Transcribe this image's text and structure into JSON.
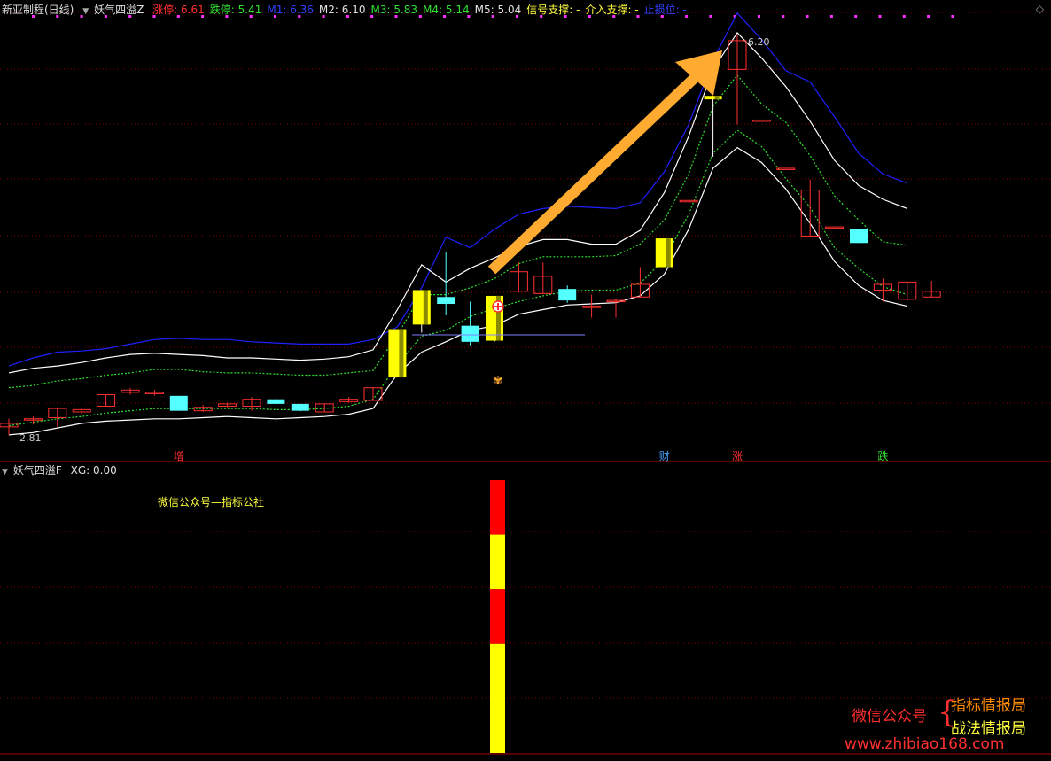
{
  "main_header": {
    "title": "新亚制程(日线)",
    "indicator": "妖气四溢Z",
    "items": [
      {
        "label": "涨停: 6.61",
        "color": "red"
      },
      {
        "label": "跌停: 5.41",
        "color": "green"
      },
      {
        "label": "M1: 6.36",
        "color": "blue"
      },
      {
        "label": "M2: 6.10",
        "color": "white"
      },
      {
        "label": "M3: 5.83",
        "color": "green"
      },
      {
        "label": "M4: 5.14",
        "color": "green"
      },
      {
        "label": "M5: 5.04",
        "color": "white"
      },
      {
        "label": "信号支撑: -",
        "color": "yellow"
      },
      {
        "label": "介入支撑: -",
        "color": "yellow"
      },
      {
        "label": "止损位: -",
        "color": "blue"
      }
    ]
  },
  "sub_header": {
    "indicator": "妖气四溢F",
    "xg": "XG: 0.00"
  },
  "watermark": "微信公众号—指标公社",
  "promo": {
    "left": "微信公众号",
    "brace": "{",
    "line1": "指标情报局",
    "line2": "战法情报局",
    "url": "www.zhibiao168.com"
  },
  "colors": {
    "up": "#ff3030",
    "down": "#54ffff",
    "signal": "#ffff00",
    "upper": "#2020ff",
    "band": "#ffffff",
    "dotted": "#30e030",
    "arrow": "#ffaa30",
    "grid": "#8b0000"
  },
  "chart_data": {
    "type": "candlestick",
    "price_high_label": "6.20",
    "price_low_label": "2.81",
    "candles": [
      {
        "o": 2.84,
        "c": 2.87,
        "h": 2.91,
        "l": 2.77
      },
      {
        "o": 2.9,
        "c": 2.91,
        "h": 2.93,
        "l": 2.86
      },
      {
        "o": 2.92,
        "c": 3.0,
        "h": 3.01,
        "l": 2.84
      },
      {
        "o": 2.97,
        "c": 2.99,
        "h": 3.0,
        "l": 2.94
      },
      {
        "o": 3.02,
        "c": 3.12,
        "h": 3.12,
        "l": 3.02
      },
      {
        "o": 3.14,
        "c": 3.16,
        "h": 3.18,
        "l": 3.12
      },
      {
        "o": 3.14,
        "c": 3.14,
        "h": 3.16,
        "l": 3.11
      },
      {
        "o": 3.11,
        "c": 2.98,
        "h": 3.11,
        "l": 2.98
      },
      {
        "o": 2.98,
        "c": 3.01,
        "h": 3.03,
        "l": 2.97
      },
      {
        "o": 3.02,
        "c": 3.04,
        "h": 3.05,
        "l": 3.01
      },
      {
        "o": 3.02,
        "c": 3.08,
        "h": 3.1,
        "l": 2.98
      },
      {
        "o": 3.08,
        "c": 3.04,
        "h": 3.1,
        "l": 3.03
      },
      {
        "o": 3.04,
        "c": 2.98,
        "h": 3.04,
        "l": 2.97
      },
      {
        "o": 2.97,
        "c": 3.04,
        "h": 3.04,
        "l": 2.97
      },
      {
        "o": 3.06,
        "c": 3.08,
        "h": 3.1,
        "l": 3.05
      },
      {
        "o": 3.07,
        "c": 3.18,
        "h": 3.18,
        "l": 3.07
      },
      {
        "o": 3.27,
        "c": 3.69,
        "h": 3.69,
        "l": 3.27,
        "signal": true
      },
      {
        "o": 3.73,
        "c": 4.03,
        "h": 4.03,
        "l": 3.66,
        "signal": true
      },
      {
        "o": 3.97,
        "c": 3.91,
        "h": 4.36,
        "l": 3.81
      },
      {
        "o": 3.72,
        "c": 3.58,
        "h": 3.93,
        "l": 3.55
      },
      {
        "o": 3.59,
        "c": 3.98,
        "h": 3.98,
        "l": 3.58,
        "signal": true
      },
      {
        "o": 4.02,
        "c": 4.19,
        "h": 4.27,
        "l": 4.01
      },
      {
        "o": 4.0,
        "c": 4.15,
        "h": 4.27,
        "l": 4.0
      },
      {
        "o": 4.04,
        "c": 3.94,
        "h": 4.07,
        "l": 3.92
      },
      {
        "o": 3.89,
        "c": 3.89,
        "h": 3.99,
        "l": 3.79
      },
      {
        "o": 3.94,
        "c": 3.94,
        "h": 3.95,
        "l": 3.79
      },
      {
        "o": 3.97,
        "c": 4.08,
        "h": 4.23,
        "l": 3.97
      },
      {
        "o": 4.48,
        "c": 4.23,
        "h": 4.48,
        "l": 4.23,
        "signal": true
      },
      {
        "o": 4.81,
        "c": 4.81,
        "h": 4.81,
        "l": 4.81
      },
      {
        "o": 5.72,
        "c": 5.69,
        "h": 5.72,
        "l": 5.19,
        "signal": true
      },
      {
        "o": 5.95,
        "c": 6.2,
        "h": 6.25,
        "l": 5.47
      },
      {
        "o": 5.51,
        "c": 5.51,
        "h": 5.51,
        "l": 5.51
      },
      {
        "o": 5.09,
        "c": 5.09,
        "h": 5.09,
        "l": 5.09
      },
      {
        "o": 4.5,
        "c": 4.9,
        "h": 4.99,
        "l": 4.5
      },
      {
        "o": 4.58,
        "c": 4.58,
        "h": 4.58,
        "l": 4.58
      },
      {
        "o": 4.56,
        "c": 4.44,
        "h": 4.56,
        "l": 4.44
      },
      {
        "o": 4.03,
        "c": 4.08,
        "h": 4.13,
        "l": 3.93
      },
      {
        "o": 3.95,
        "c": 4.1,
        "h": 4.1,
        "l": 3.94
      },
      {
        "o": 3.97,
        "c": 4.02,
        "h": 4.11,
        "l": 3.97
      }
    ],
    "line_m1_upper": [
      3.37,
      3.44,
      3.49,
      3.5,
      3.52,
      3.56,
      3.6,
      3.61,
      3.6,
      3.6,
      3.58,
      3.57,
      3.56,
      3.56,
      3.56,
      3.6,
      3.71,
      4.05,
      4.49,
      4.4,
      4.56,
      4.69,
      4.74,
      4.76,
      4.75,
      4.74,
      4.79,
      5.06,
      5.47,
      6.03,
      6.44,
      6.21,
      5.94,
      5.84,
      5.54,
      5.22,
      5.04,
      4.96
    ],
    "line_m2_white": [
      3.31,
      3.35,
      3.37,
      3.4,
      3.44,
      3.47,
      3.48,
      3.47,
      3.46,
      3.44,
      3.44,
      3.43,
      3.42,
      3.43,
      3.45,
      3.51,
      3.86,
      4.25,
      4.1,
      4.22,
      4.31,
      4.41,
      4.47,
      4.47,
      4.43,
      4.43,
      4.55,
      4.88,
      5.37,
      5.95,
      6.27,
      6.05,
      5.8,
      5.5,
      5.16,
      4.94,
      4.82,
      4.74
    ],
    "line_m3_dotted": [
      3.18,
      3.2,
      3.24,
      3.26,
      3.29,
      3.31,
      3.34,
      3.34,
      3.32,
      3.31,
      3.31,
      3.3,
      3.29,
      3.29,
      3.31,
      3.33,
      3.64,
      3.99,
      3.99,
      4.05,
      4.13,
      4.26,
      4.32,
      4.32,
      4.32,
      4.33,
      4.43,
      4.64,
      5.04,
      5.63,
      5.9,
      5.65,
      5.49,
      5.2,
      4.85,
      4.64,
      4.45,
      4.42
    ],
    "line_m4_dotted": [
      2.85,
      2.88,
      2.91,
      2.93,
      2.96,
      2.98,
      3.0,
      3.0,
      3.0,
      3.0,
      3.0,
      2.99,
      2.99,
      3.0,
      3.02,
      3.08,
      3.38,
      3.63,
      3.68,
      3.8,
      3.87,
      3.93,
      3.98,
      4.02,
      4.03,
      4.03,
      4.09,
      4.3,
      4.69,
      5.22,
      5.42,
      5.28,
      5.0,
      4.75,
      4.4,
      4.22,
      4.06,
      3.99
    ],
    "line_m5_white": [
      2.77,
      2.79,
      2.83,
      2.87,
      2.89,
      2.9,
      2.91,
      2.91,
      2.92,
      2.93,
      2.92,
      2.91,
      2.92,
      2.93,
      2.95,
      3.0,
      3.3,
      3.49,
      3.58,
      3.68,
      3.72,
      3.82,
      3.86,
      3.9,
      3.91,
      3.92,
      3.98,
      4.17,
      4.56,
      5.09,
      5.27,
      5.14,
      4.91,
      4.61,
      4.28,
      4.07,
      3.94,
      3.89
    ],
    "annotations": [
      {
        "index": 7,
        "text": "增",
        "color": "#ff3030"
      },
      {
        "index": 27,
        "text": "财",
        "color": "#40a0ff"
      },
      {
        "index": 30,
        "text": "涨",
        "color": "#ff3030"
      },
      {
        "index": 36,
        "text": "跌",
        "color": "#30e030"
      }
    ],
    "sub_bar": {
      "index": 20,
      "segments": [
        {
          "color": "#ff0000",
          "weight": 1
        },
        {
          "color": "#ffff00",
          "weight": 1
        },
        {
          "color": "#ff0000",
          "weight": 1
        },
        {
          "color": "#ffff00",
          "weight": 2
        }
      ]
    }
  }
}
